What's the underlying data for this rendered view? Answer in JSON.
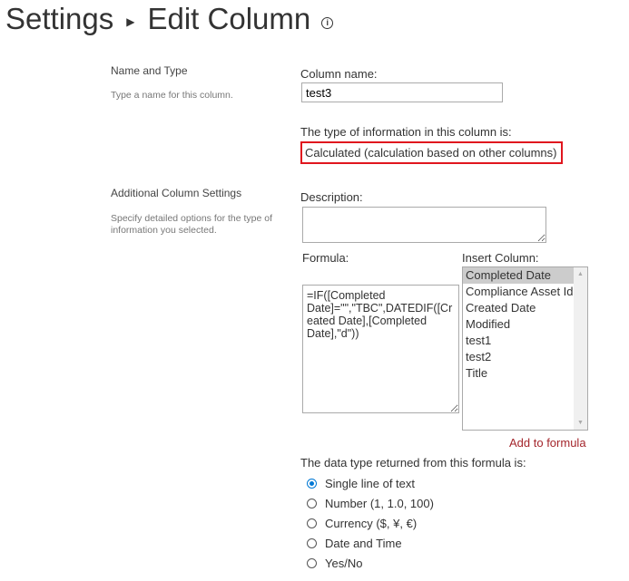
{
  "header": {
    "breadcrumb": "Settings",
    "title": "Edit Column",
    "info_icon": "info-icon"
  },
  "name_type": {
    "heading": "Name and Type",
    "description": "Type a name for this column.",
    "column_name_label": "Column name:",
    "column_name_value": "test3",
    "type_label": "The type of information in this column is:",
    "type_value": "Calculated (calculation based on other columns)",
    "highlight_color": "#e0161e"
  },
  "additional": {
    "heading": "Additional Column Settings",
    "description": "Specify detailed options for the type of information you selected.",
    "description_label": "Description:",
    "description_value": "",
    "formula_label": "Formula:",
    "formula_value": "=IF([Completed Date]=\"\",\"TBC\",DATEDIF([Created Date],[Completed Date],\"d\"))",
    "insert_column_label": "Insert Column:",
    "columns": [
      "Completed Date",
      "Compliance Asset Id",
      "Created Date",
      "Modified",
      "test1",
      "test2",
      "Title"
    ],
    "selected_column": "Completed Date",
    "add_to_formula": "Add to formula",
    "return_type_label": "The data type returned from this formula is:",
    "return_types": [
      "Single line of text",
      "Number (1, 1.0, 100)",
      "Currency ($, ¥, €)",
      "Date and Time",
      "Yes/No"
    ],
    "selected_return_type": "Single line of text"
  }
}
